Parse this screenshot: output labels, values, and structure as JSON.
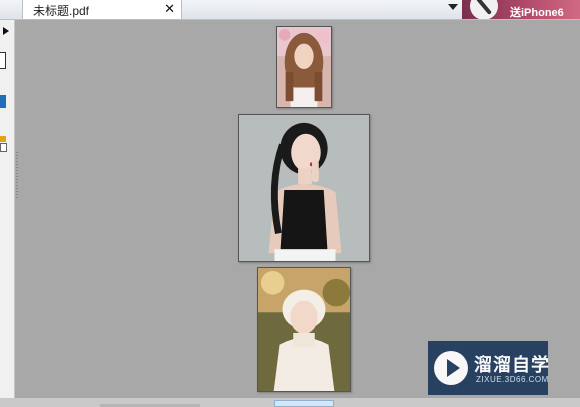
{
  "document_tab": {
    "title": "未标题.pdf",
    "close_glyph": "✕"
  },
  "ad_banner": {
    "text": "送iPhone6"
  },
  "sidebar": {
    "expand_icon": "triangle-right-icon",
    "items": [
      "page-thumbnail-icon",
      "bookmark-icon",
      "attachment-icon"
    ]
  },
  "pages": [
    {
      "name": "page-1",
      "image": "portrait photo of woman with long wavy hair and floral crown"
    },
    {
      "name": "page-2",
      "image": "portrait photo of woman in black sleeveless top, hand near face"
    },
    {
      "name": "page-3",
      "image": "portrait photo of woman wearing white lace outfit outdoors"
    }
  ],
  "watermark": {
    "brand": "溜溜自学",
    "url": "ZIXUE.3D66.COM"
  },
  "colors": {
    "canvas": "#a8a8a8",
    "tab_bg": "#ffffff",
    "watermark_bg": "#1f3a5c"
  }
}
